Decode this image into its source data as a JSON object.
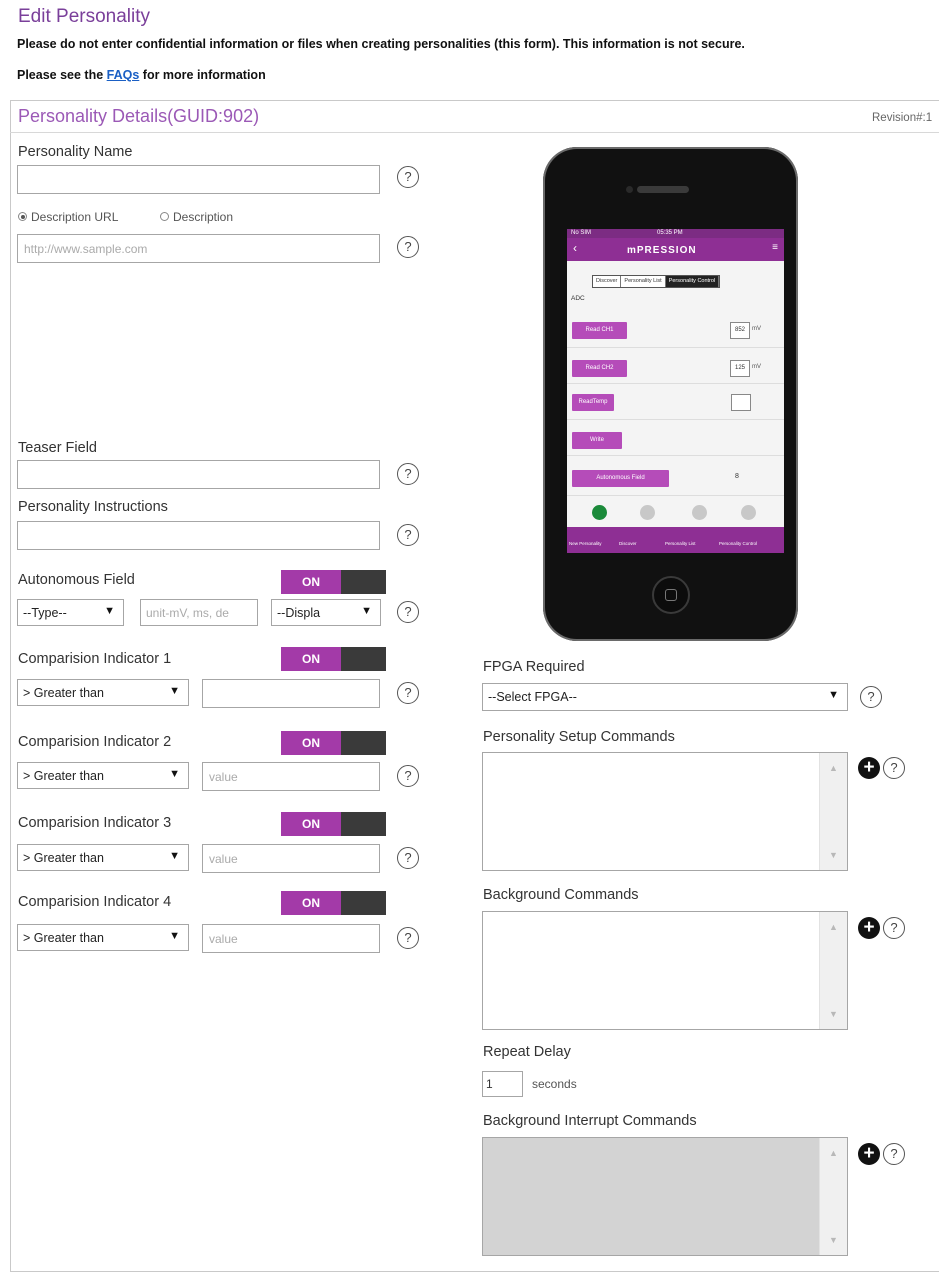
{
  "page": {
    "title": "Edit Personality",
    "warning_line1": "Please do not enter confidential information or files when creating personalities (this form). This information is not secure.",
    "warning_line2_prefix": "Please see the ",
    "warning_link": "FAQs",
    "warning_line2_suffix": " for more information"
  },
  "panel": {
    "title": "Personality Details(GUID:902)",
    "revision": "Revision#:1"
  },
  "form": {
    "personality_name_label": "Personality Name",
    "personality_name_value": "",
    "desc_url_radio": "Description URL",
    "desc_radio": "Description",
    "desc_url_placeholder": "http://www.sample.com",
    "teaser_label": "Teaser Field",
    "teaser_value": "",
    "instructions_label": "Personality Instructions",
    "instructions_value": "",
    "autonomous_label": "Autonomous Field",
    "autonomous_toggle": "ON",
    "type_select": "--Type--",
    "unit_placeholder": "unit-mV, ms, de",
    "display_select": "--Displa",
    "comparisons": [
      {
        "label": "Comparision Indicator 1",
        "toggle": "ON",
        "operator": "> Greater than",
        "value": "",
        "placeholder": ""
      },
      {
        "label": "Comparision Indicator 2",
        "toggle": "ON",
        "operator": "> Greater than",
        "value": "",
        "placeholder": "value"
      },
      {
        "label": "Comparision Indicator 3",
        "toggle": "ON",
        "operator": "> Greater than",
        "value": "",
        "placeholder": "value"
      },
      {
        "label": "Comparision Indicator 4",
        "toggle": "ON",
        "operator": "> Greater than",
        "value": "",
        "placeholder": "value"
      }
    ],
    "fpga_label": "FPGA Required",
    "fpga_select": "--Select FPGA--",
    "setup_label": "Personality Setup Commands",
    "background_label": "Background Commands",
    "repeat_delay_label": "Repeat Delay",
    "repeat_delay_value": "1",
    "repeat_delay_unit": "seconds",
    "interrupt_label": "Background Interrupt Commands"
  },
  "help_glyph": "?",
  "plus_glyph": "+",
  "phone": {
    "carrier": "No SIM",
    "time": "05:35 PM",
    "logo": "mPRESSION",
    "tabs": [
      "Discover",
      "Personality List",
      "Personality Control"
    ],
    "section": "ADC",
    "buttons": [
      "Read CH1",
      "Read CH2",
      "ReadTemp",
      "Write",
      "Autonomous Field"
    ],
    "ch1_value": "852",
    "ch2_value": "125",
    "unit": "mV",
    "autonomous_value": "8",
    "nav": [
      "New Personality",
      "Discover",
      "Personality List",
      "Personality Control"
    ],
    "status_dot_colors": [
      "#1b8a3a",
      "#c8c8c8",
      "#c8c8c8",
      "#c8c8c8"
    ]
  },
  "colors": {
    "accent": "#9b59b6",
    "toggle_on": "#a33aa8",
    "link": "#1a5fc4"
  }
}
